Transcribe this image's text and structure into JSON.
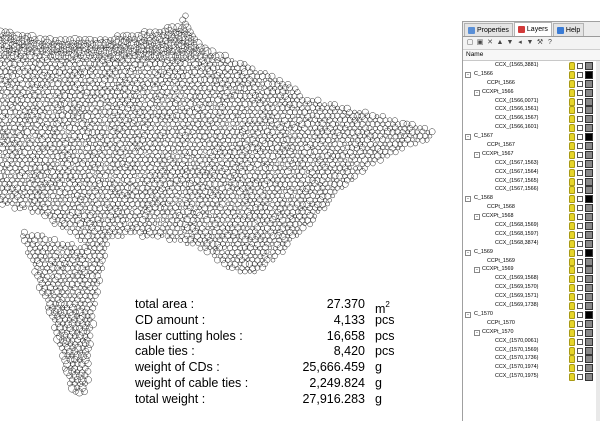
{
  "stats": [
    {
      "label": "total area :",
      "value": "27.370",
      "unit": "m",
      "sup": "2"
    },
    {
      "label": "CD amount :",
      "value": "4,133",
      "unit": "pcs"
    },
    {
      "label": "laser cutting holes :",
      "value": "16,658",
      "unit": "pcs"
    },
    {
      "label": "cable ties :",
      "value": "8,420",
      "unit": "pcs"
    },
    {
      "label": "weight of CDs :",
      "value": "25,666.459",
      "unit": "g"
    },
    {
      "label": "weight of cable ties :",
      "value": "2,249.824",
      "unit": "g"
    },
    {
      "label": "total weight :",
      "value": "27,916.283",
      "unit": "g"
    }
  ],
  "panel": {
    "tabs": [
      {
        "label": "Properties",
        "icon": "properties-icon",
        "color": "#5a8fd6"
      },
      {
        "label": "Layers",
        "icon": "layers-icon",
        "color": "#d23a3a"
      },
      {
        "label": "Help",
        "icon": "help-icon",
        "color": "#3a7bd5"
      }
    ],
    "toolbar": [
      "new-layer-icon",
      "new-sublayer-icon",
      "delete-icon",
      "move-up-icon",
      "move-down-icon",
      "move-to-parent-icon",
      "filter-icon",
      "tools-icon",
      "help-icon"
    ],
    "column_header": "Name",
    "layers": [
      {
        "name": "CCX_(1565,3881)",
        "depth": 4,
        "expander": "",
        "color": "#888888"
      },
      {
        "name": "C_1566",
        "depth": 0,
        "expander": "-",
        "color": "#000000"
      },
      {
        "name": "CCPt_1566",
        "depth": 2,
        "expander": "",
        "color": "#888888"
      },
      {
        "name": "CCXPt_1566",
        "depth": 1,
        "expander": "-",
        "color": "#888888"
      },
      {
        "name": "CCX_(1566,0071)",
        "depth": 4,
        "expander": "",
        "color": "#888888"
      },
      {
        "name": "CCX_(1566,1561)",
        "depth": 4,
        "expander": "",
        "color": "#888888"
      },
      {
        "name": "CCX_(1566,1567)",
        "depth": 4,
        "expander": "",
        "color": "#888888"
      },
      {
        "name": "CCX_(1566,1601)",
        "depth": 4,
        "expander": "",
        "color": "#888888"
      },
      {
        "name": "C_1567",
        "depth": 0,
        "expander": "-",
        "color": "#000000"
      },
      {
        "name": "CCPt_1567",
        "depth": 2,
        "expander": "",
        "color": "#888888"
      },
      {
        "name": "CCXPt_1567",
        "depth": 1,
        "expander": "-",
        "color": "#888888"
      },
      {
        "name": "CCX_(1567,1563)",
        "depth": 4,
        "expander": "",
        "color": "#888888"
      },
      {
        "name": "CCX_(1567,1564)",
        "depth": 4,
        "expander": "",
        "color": "#888888"
      },
      {
        "name": "CCX_(1567,1565)",
        "depth": 4,
        "expander": "",
        "color": "#888888"
      },
      {
        "name": "CCX_(1567,1566)",
        "depth": 4,
        "expander": "",
        "color": "#888888"
      },
      {
        "name": "C_1568",
        "depth": 0,
        "expander": "-",
        "color": "#000000"
      },
      {
        "name": "CCPt_1568",
        "depth": 2,
        "expander": "",
        "color": "#888888"
      },
      {
        "name": "CCXPt_1568",
        "depth": 1,
        "expander": "-",
        "color": "#888888"
      },
      {
        "name": "CCX_(1568,1569)",
        "depth": 4,
        "expander": "",
        "color": "#888888"
      },
      {
        "name": "CCX_(1568,1597)",
        "depth": 4,
        "expander": "",
        "color": "#888888"
      },
      {
        "name": "CCX_(1568,3874)",
        "depth": 4,
        "expander": "",
        "color": "#888888"
      },
      {
        "name": "C_1569",
        "depth": 0,
        "expander": "-",
        "color": "#000000"
      },
      {
        "name": "CCPt_1569",
        "depth": 2,
        "expander": "",
        "color": "#888888"
      },
      {
        "name": "CCXPt_1569",
        "depth": 1,
        "expander": "-",
        "color": "#888888"
      },
      {
        "name": "CCX_(1569,1568)",
        "depth": 4,
        "expander": "",
        "color": "#888888"
      },
      {
        "name": "CCX_(1569,1570)",
        "depth": 4,
        "expander": "",
        "color": "#888888"
      },
      {
        "name": "CCX_(1569,1571)",
        "depth": 4,
        "expander": "",
        "color": "#888888"
      },
      {
        "name": "CCX_(1569,1738)",
        "depth": 4,
        "expander": "",
        "color": "#888888"
      },
      {
        "name": "C_1570",
        "depth": 0,
        "expander": "-",
        "color": "#000000"
      },
      {
        "name": "CCPt_1570",
        "depth": 2,
        "expander": "",
        "color": "#888888"
      },
      {
        "name": "CCXPt_1570",
        "depth": 1,
        "expander": "-",
        "color": "#888888"
      },
      {
        "name": "CCX_(1570,0061)",
        "depth": 4,
        "expander": "",
        "color": "#888888"
      },
      {
        "name": "CCX_(1570,1569)",
        "depth": 4,
        "expander": "",
        "color": "#888888"
      },
      {
        "name": "CCX_(1570,1736)",
        "depth": 4,
        "expander": "",
        "color": "#888888"
      },
      {
        "name": "CCX_(1570,1974)",
        "depth": 4,
        "expander": "",
        "color": "#888888"
      },
      {
        "name": "CCX_(1570,1975)",
        "depth": 4,
        "expander": "",
        "color": "#888888"
      }
    ]
  }
}
